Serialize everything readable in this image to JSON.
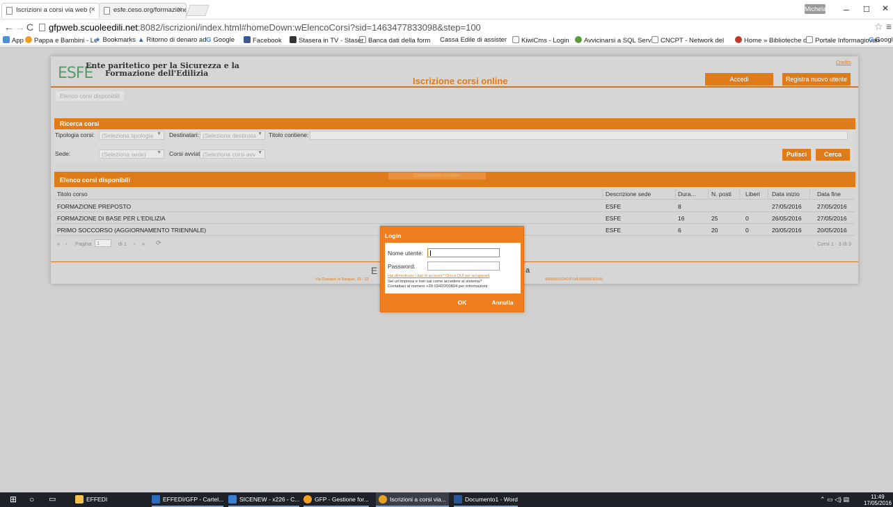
{
  "browser": {
    "tabs": [
      {
        "label": "Iscrizioni a corsi via web (",
        "active": true
      },
      {
        "label": "esfe.ceso.org/formazione",
        "active": false
      }
    ],
    "user_badge": "Michela",
    "window_controls": {
      "minimize": "–",
      "maximize": "☐",
      "close": "✕"
    },
    "url_host": "gfpweb.scuoleedili.net",
    "url_rest": ":8082/iscrizioni/index.html#homeDown:wElencoCorsi?sid=1463477833098&step=100",
    "bookmarks": [
      {
        "label": "App",
        "icon": "apps-grid-icon",
        "color": "#4a90d9"
      },
      {
        "label": "Pappa e Bambini - Le",
        "icon": "site-icon",
        "color": "#f0a020"
      },
      {
        "label": "Bookmarks",
        "icon": "star-icon",
        "color": "#3a6fc4"
      },
      {
        "label": "Ritorno di denaro ad",
        "icon": "site-icon",
        "color": "#2c5fa8"
      },
      {
        "label": "Google",
        "icon": "google-icon",
        "color": "#4285f4"
      },
      {
        "label": "Facebook",
        "icon": "facebook-icon",
        "color": "#3b5998"
      },
      {
        "label": "Stasera in TV - Staser",
        "icon": "tv-icon",
        "color": "#333333"
      },
      {
        "label": "Banca dati della form",
        "icon": "page-icon",
        "color": "#888888"
      },
      {
        "label": "Cassa Edile di assister",
        "icon": "site-icon",
        "color": "#cccccc"
      },
      {
        "label": "KiwiCms - Login",
        "icon": "page-icon",
        "color": "#888888"
      },
      {
        "label": "Avvicinarsi a SQL Serv",
        "icon": "site-icon",
        "color": "#5a9b3a"
      },
      {
        "label": "CNCPT - Network del",
        "icon": "page-icon",
        "color": "#888888"
      },
      {
        "label": "Home » Biblioteche d",
        "icon": "site-icon",
        "color": "#c0392b"
      },
      {
        "label": "Portale Informagiovan",
        "icon": "page-icon",
        "color": "#888888"
      },
      {
        "label": "Google",
        "icon": "google-icon",
        "color": "#4285f4"
      }
    ]
  },
  "site": {
    "logo": "ESFE",
    "org_line1": "Ente paritetico per la Sicurezza e la",
    "org_line2": "Formazione dell'Edilizia",
    "title": "Iscrizione corsi online",
    "credits": "Credits",
    "login_button": "Accedi",
    "register_button": "Registra nuovo utente",
    "breadcrumb": "Elenco corsi disponibili",
    "accent": "#e07b1a"
  },
  "search": {
    "title": "Ricerca corsi",
    "tipologia_label": "Tipologia corsi:",
    "tipologia_value": "(Seleziona tipologia",
    "destinatari_label": "Destinatari:",
    "destinatari_value": "(Seleziona destinata",
    "titolo_label": "Titolo contiene:",
    "titolo_value": "",
    "sede_label": "Sede:",
    "sede_value": "(Seleziona sede)",
    "avviati_label": "Corsi avviati:",
    "avviati_value": "(Seleziona corsi avv",
    "clear_button": "Pulisci",
    "search_button": "Cerca"
  },
  "list": {
    "title": "Elenco corsi disponibili",
    "loading": "Caricamento in corso",
    "columns": [
      "Titolo corso",
      "Descrizione sede",
      "Dura...",
      "N. posti",
      "Liberi",
      "Data inizio",
      "Data fine"
    ],
    "rows": [
      [
        "FORMAZIONE PREPOSTO",
        "ESFE",
        "8",
        "",
        "",
        "27/05/2016",
        "27/05/2016"
      ],
      [
        "FORMAZIONE DI BASE PER L'EDILIZIA",
        "ESFE",
        "16",
        "25",
        "0",
        "26/05/2016",
        "27/05/2016"
      ],
      [
        "PRIMO SOCCORSO (AGGIORNAMENTO TRIENNALE)",
        "ESFE",
        "6",
        "20",
        "0",
        "20/05/2016",
        "20/05/2016"
      ]
    ],
    "pager_page_label": "Pagina",
    "pager_page_value": "1",
    "pager_of": "di 1",
    "pager_summary": "Corsi 1 - 3 di 3"
  },
  "footer": {
    "big_left": "E",
    "big_right": "a",
    "address": "Via Donatori di Sangue, 15 - 23",
    "fiscal": "00055010140 P.IVA 00055010145"
  },
  "login": {
    "title": "Login",
    "username_label": "Nome utente:",
    "username_value": "",
    "password_label": "Password:",
    "password_value": "",
    "forgot_link": "Hai dimenticato i dati di accesso? Clicca QUI per recuperarli",
    "note_line1": "Sei un'impresa e non sai come accedere al sistema?",
    "note_line2": "Contattaci al numero +39 0342/200824 per informazioni",
    "ok_button": "OK",
    "cancel_button": "Annulla"
  },
  "taskbar": {
    "items": [
      {
        "label": "EFFEDI",
        "icon": "folder-icon",
        "color": "#f2c14e"
      },
      {
        "label": "EFFEDI/GFP - Cartel...",
        "icon": "outlook-icon",
        "color": "#2a6ebb"
      },
      {
        "label": "SICENEW - x226 - C...",
        "icon": "remote-desktop-icon",
        "color": "#3c7fd1"
      },
      {
        "label": "GFP - Gestione for...",
        "icon": "app-icon",
        "color": "#f0a020"
      },
      {
        "label": "Iscrizioni a corsi via...",
        "icon": "chrome-icon",
        "color": "#e8a020"
      },
      {
        "label": "Documento1 - Word",
        "icon": "word-icon",
        "color": "#2b579a"
      }
    ],
    "time": "11:49",
    "date": "17/05/2016"
  }
}
